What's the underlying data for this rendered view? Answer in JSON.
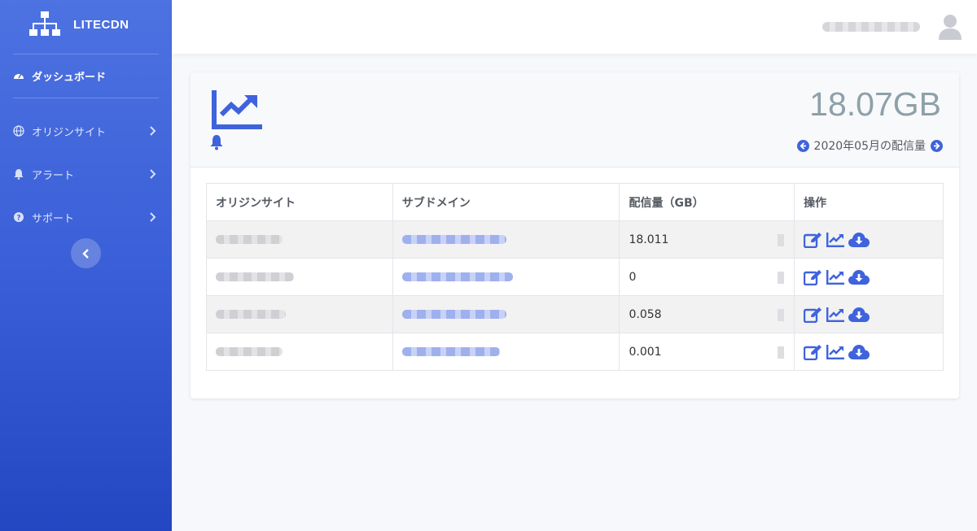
{
  "brand": {
    "name": "LITECDN"
  },
  "sidebar": {
    "items": [
      {
        "label": "ダッシュボード",
        "icon": "gauge-icon",
        "active": true
      },
      {
        "label": "オリジンサイト",
        "icon": "globe-icon"
      },
      {
        "label": "アラート",
        "icon": "bell-icon"
      },
      {
        "label": "サポート",
        "icon": "question-circle-icon"
      }
    ]
  },
  "summary": {
    "total": "18.07GB",
    "period": "2020年05月の配信量"
  },
  "table": {
    "headers": [
      "オリジンサイト",
      "サブドメイン",
      "配信量（GB）",
      "操作"
    ],
    "rows": [
      {
        "volume": "18.011"
      },
      {
        "volume": "0"
      },
      {
        "volume": "0.058"
      },
      {
        "volume": "0.001"
      }
    ]
  },
  "colors": {
    "accent": "#3f63dc",
    "total_text": "#8ea0a8"
  }
}
